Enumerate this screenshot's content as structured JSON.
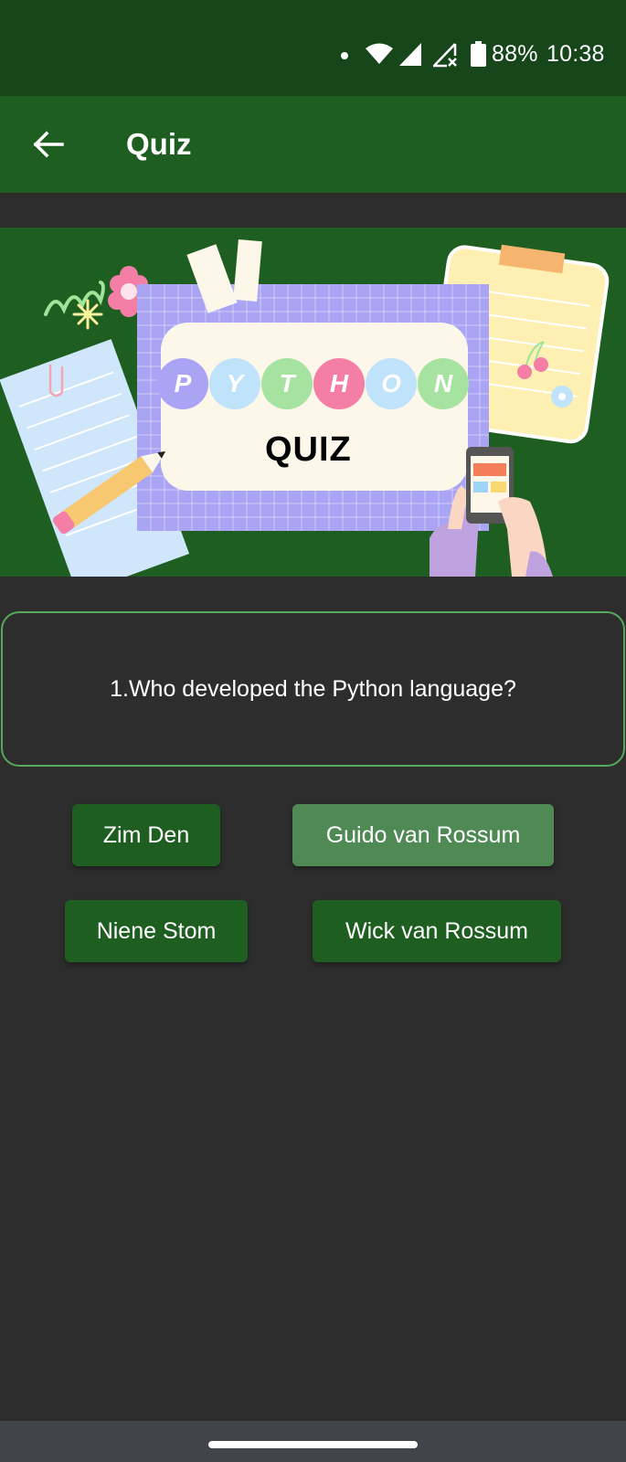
{
  "status_bar": {
    "battery": "88%",
    "time": "10:38",
    "icons": [
      "notification-dot-icon",
      "wifi-icon",
      "signal-icon",
      "signal-no-data-icon",
      "battery-icon"
    ]
  },
  "app_bar": {
    "title": "Quiz",
    "back_icon": "arrow-left-icon"
  },
  "banner": {
    "python_letters": [
      "P",
      "Y",
      "T",
      "H",
      "O",
      "N"
    ],
    "letter_colors": [
      "#a9a4f4",
      "#bfe3fa",
      "#a6e3a0",
      "#f47ea5",
      "#bfe3fa",
      "#a6e3a0"
    ],
    "quiz_text": "QUIZ"
  },
  "question": {
    "text": "1.Who developed the Python language?"
  },
  "answers": [
    {
      "label": "Zim Den",
      "selected": false
    },
    {
      "label": "Guido van Rossum",
      "selected": true
    },
    {
      "label": "Niene Stom",
      "selected": false
    },
    {
      "label": "Wick van Rossum",
      "selected": false
    }
  ],
  "colors": {
    "status_bar": "#16461a",
    "app_bar": "#1e5e20",
    "background": "#2d2d2d",
    "button": "#1e5e20",
    "button_selected": "#4f8a55",
    "card_border": "#56a95a"
  }
}
